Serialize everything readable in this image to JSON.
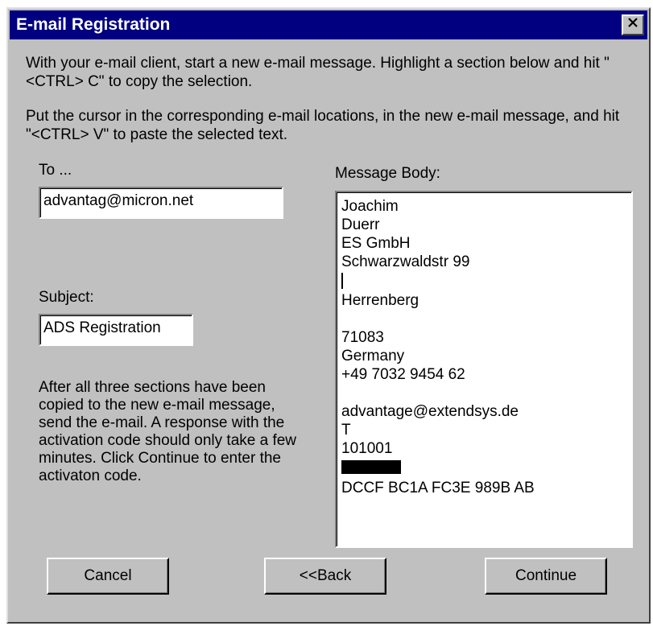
{
  "window": {
    "title": "E-mail Registration",
    "close_icon": "close-icon"
  },
  "intro": {
    "paragraph1": "With your e-mail client, start a new e-mail message. Highlight a section below and hit \"<CTRL> C\" to copy the selection.",
    "paragraph2": "Put the cursor in the corresponding e-mail locations, in the new e-mail message, and hit \"<CTRL> V\" to paste the selected text."
  },
  "to": {
    "label": "To ...",
    "value": "advantag@micron.net"
  },
  "subject": {
    "label": "Subject:",
    "value": "ADS Registration"
  },
  "message_body": {
    "label": "Message Body:",
    "lines": [
      "Joachim",
      "Duerr",
      "ES GmbH",
      "Schwarzwaldstr 99",
      "",
      "Herrenberg",
      "",
      "71083",
      "Germany",
      "+49 7032 9454 62",
      "",
      "advantage@extendsys.de",
      "T",
      "101001",
      "",
      "DCCF BC1A FC3E 989B AB"
    ]
  },
  "info_text": "After all three sections have been copied to the new e-mail message, send the e-mail. A response with the activation code should only take a few minutes. Click Continue to enter the activaton code.",
  "buttons": {
    "cancel": "Cancel",
    "back": "<<Back",
    "continue": "Continue"
  },
  "colors": {
    "titlebar": "#000080",
    "dialog_face": "#c0c0c0"
  }
}
